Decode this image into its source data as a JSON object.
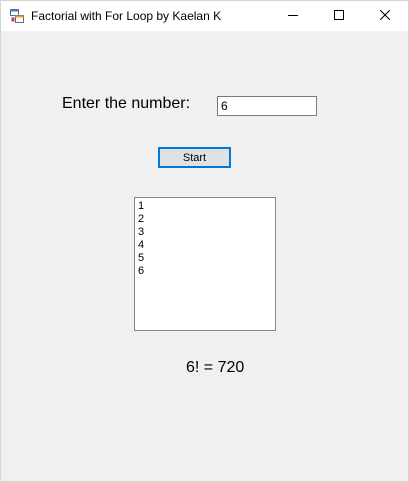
{
  "window": {
    "title": "Factorial with For Loop by Kaelan K",
    "icons": {
      "app": "app-window-icon",
      "minimize": "minimize-icon",
      "maximize": "maximize-icon",
      "close": "close-icon"
    }
  },
  "form": {
    "prompt_label": "Enter the number:",
    "number_input_value": "6",
    "start_label": "Start",
    "list_items": [
      "1",
      "2",
      "3",
      "4",
      "5",
      "6"
    ],
    "result": "6! = 720"
  },
  "colors": {
    "focus_border": "#0078d7",
    "client_background": "#f0f0f0"
  }
}
